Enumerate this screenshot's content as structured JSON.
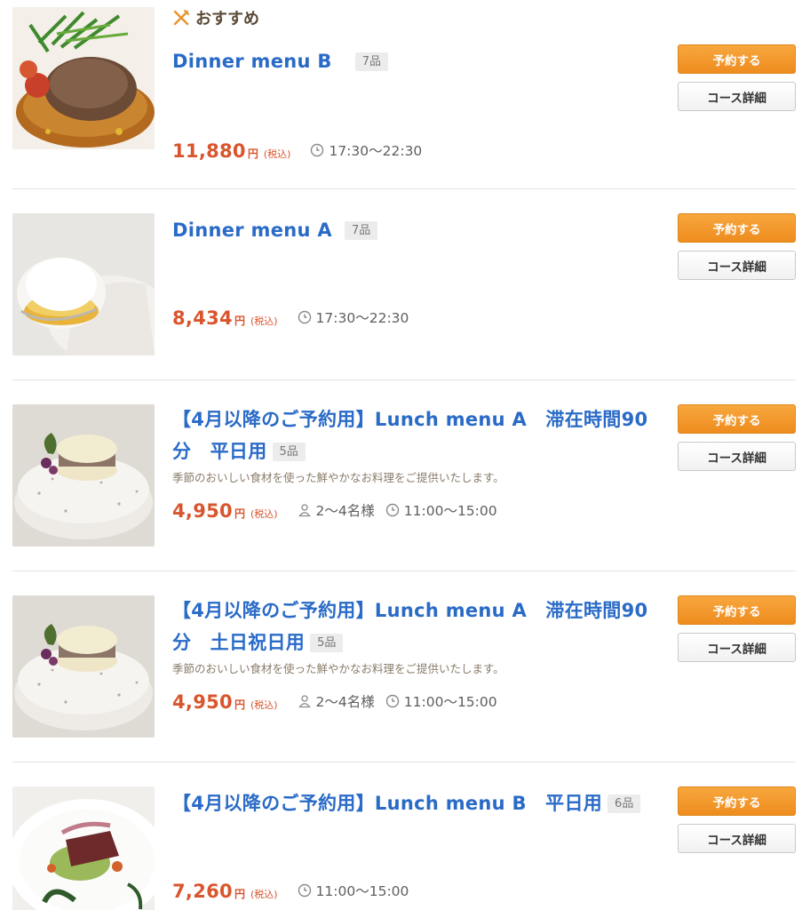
{
  "recommend_label": "おすすめ",
  "courses": [
    {
      "title": "Dinner menu B",
      "count": "7品",
      "description": "",
      "price": "11,880",
      "yen": "円",
      "tax": "(税込)",
      "people": "",
      "time": "17:30〜22:30",
      "reserve_label": "予約する",
      "detail_label": "コース詳細"
    },
    {
      "title": "Dinner menu A",
      "count": "7品",
      "description": "",
      "price": "8,434",
      "yen": "円",
      "tax": "(税込)",
      "people": "",
      "time": "17:30〜22:30",
      "reserve_label": "予約する",
      "detail_label": "コース詳細"
    },
    {
      "title": "【4月以降のご予約用】Lunch menu A　滞在時間90分　平日用",
      "count": "5品",
      "description": "季節のおいしい食材を使った鮮やかなお料理をご提供いたします。",
      "price": "4,950",
      "yen": "円",
      "tax": "(税込)",
      "people": "2〜4名様",
      "time": "11:00〜15:00",
      "reserve_label": "予約する",
      "detail_label": "コース詳細"
    },
    {
      "title": "【4月以降のご予約用】Lunch menu A　滞在時間90分　土日祝日用",
      "count": "5品",
      "description": "季節のおいしい食材を使った鮮やかなお料理をご提供いたします。",
      "price": "4,950",
      "yen": "円",
      "tax": "(税込)",
      "people": "2〜4名様",
      "time": "11:00〜15:00",
      "reserve_label": "予約する",
      "detail_label": "コース詳細"
    },
    {
      "title": "【4月以降のご予約用】Lunch menu B　平日用",
      "count": "6品",
      "description": "",
      "price": "7,260",
      "yen": "円",
      "tax": "(税込)",
      "people": "",
      "time": "11:00〜15:00",
      "reserve_label": "予約する",
      "detail_label": "コース詳細"
    }
  ],
  "colors": {
    "title": "#2a6bc7",
    "price": "#d9552d",
    "reserve_button": "#f39a2c",
    "divider": "#e6e2dc"
  },
  "icons": {
    "recommend": "utensils-icon",
    "time": "clock-icon",
    "people": "person-icon"
  }
}
